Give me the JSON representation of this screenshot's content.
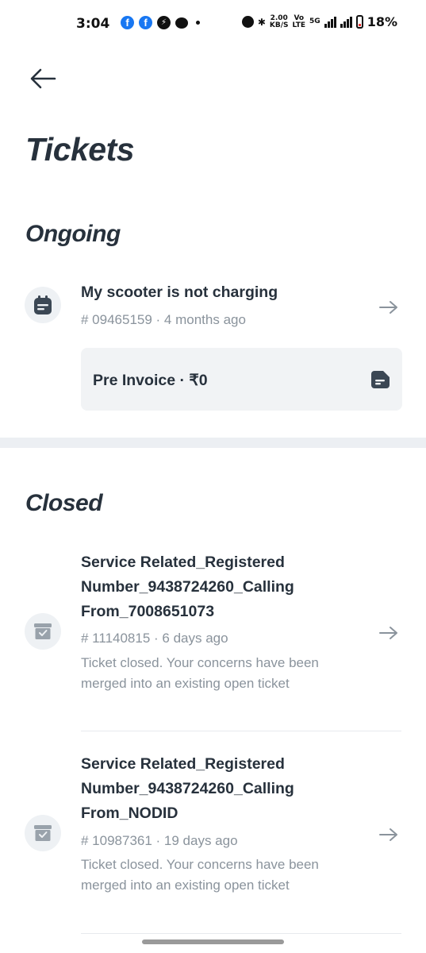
{
  "status_bar": {
    "time": "3:04",
    "fb_glyph": "f",
    "speed_value": "2.00",
    "speed_unit": "KB/S",
    "volte_top": "Vo",
    "volte_bottom": "LTE",
    "network": "5G",
    "battery": "18%"
  },
  "header": {
    "title": "Tickets"
  },
  "ongoing": {
    "heading": "Ongoing",
    "tickets": [
      {
        "title": "My scooter is not charging",
        "meta": "# 09465159 · 4 months ago",
        "invoice_label": "Pre Invoice · ₹0"
      }
    ]
  },
  "closed": {
    "heading": "Closed",
    "tickets": [
      {
        "title": "Service Related_Registered Number_9438724260_Calling From_7008651073",
        "meta": "# 11140815 · 6 days ago",
        "note": "Ticket closed. Your concerns have been merged into an existing open ticket"
      },
      {
        "title": "Service Related_Registered Number_9438724260_Calling From_NODID",
        "meta": "# 10987361 · 19 days ago",
        "note": "Ticket closed. Your concerns have been merged into an existing open ticket"
      }
    ]
  },
  "icons": {
    "back": "arrow-left-icon",
    "ongoing_ticket": "calendar-icon",
    "closed_ticket": "archive-box-icon",
    "open_ticket": "arrow-right-icon",
    "invoice": "document-icon"
  },
  "colors": {
    "text_primary": "#27313c",
    "text_secondary": "#8a939c",
    "icon_bg": "#eef1f4",
    "invoice_bg": "#f1f3f5",
    "divider": "#eceff3",
    "facebook_blue": "#1877f2"
  }
}
